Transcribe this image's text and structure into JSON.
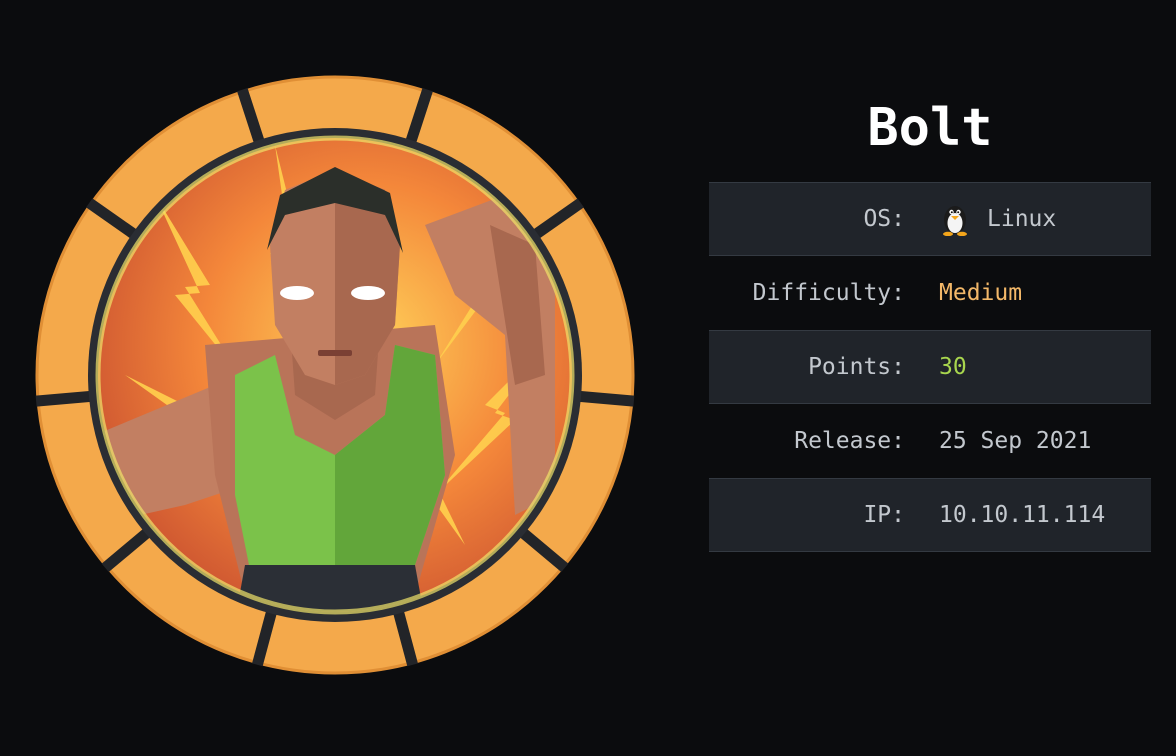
{
  "machine": {
    "name": "Bolt"
  },
  "info": {
    "os_label": "OS:",
    "os_value": "Linux",
    "os_icon": "tux-penguin-icon",
    "difficulty_label": "Difficulty:",
    "difficulty_value": "Medium",
    "points_label": "Points:",
    "points_value": "30",
    "release_label": "Release:",
    "release_value": "25 Sep 2021",
    "ip_label": "IP:",
    "ip_value": "10.10.11.114"
  },
  "colors": {
    "background": "#0b0c0e",
    "difficulty_medium": "#f3b869",
    "points": "#a8d64e",
    "badge_ring": "#f4a94b"
  }
}
